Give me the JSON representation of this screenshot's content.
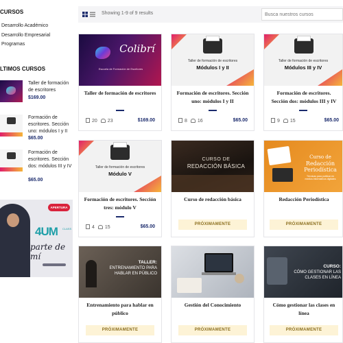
{
  "sidebar": {
    "categories_heading": "CURSOS",
    "categories": [
      "Desarrollo Académico",
      "Desarrollo Empresarial",
      "Programas"
    ],
    "recent_heading": "LTIMOS CURSOS",
    "recent": [
      {
        "title": "Taller de formación de escritores",
        "price": "$169.00"
      },
      {
        "title": "Formación de escritores. Sección uno: módulos I y II",
        "price": "$65.00"
      },
      {
        "title": "Formación de escritores. Sección dos: módulos III y IV",
        "price": "$65.00"
      }
    ],
    "promo": {
      "badge": "APERTURA",
      "logo": "4UM",
      "logo_small": "CLASS",
      "tagline": "parte de mí"
    }
  },
  "toolbar": {
    "results": "Showing 1-9 of 9 results",
    "search_placeholder": "Busca nuestros cursos"
  },
  "cards": [
    {
      "title": "Taller de formación de escritores",
      "lessons": "20",
      "students": "23",
      "price": "$169.00",
      "img": {
        "line1": "Colibrí",
        "line2": "Escuela de Formación de Escritores"
      }
    },
    {
      "title": "Formación de escritores. Sección uno: módulos I y II",
      "lessons": "8",
      "students": "16",
      "price": "$65.00",
      "img": {
        "line1": "Taller de formación de escritores",
        "line2": "Módulos I y II"
      }
    },
    {
      "title": "Formación de escritores. Sección dos: módulos III y IV",
      "lessons": "9",
      "students": "15",
      "price": "$65.00",
      "img": {
        "line1": "Taller de formación de escritores",
        "line2": "Módulos III y IV"
      }
    },
    {
      "title": "Formación de escritores. Sección tres: módulo V",
      "lessons": "4",
      "students": "15",
      "price": "$65.00",
      "img": {
        "line1": "Taller de formación de escritores",
        "line2": "Módulo V"
      }
    },
    {
      "title": "Curso de redacción básica",
      "soon": "PRÓXIMAMENTE",
      "img": {
        "line1": "CURSO DE",
        "line2": "REDACCIÓN BÁSICA"
      }
    },
    {
      "title": "Redacción Periodística",
      "soon": "PRÓXIMAMENTE",
      "img": {
        "line1": "Curso de",
        "line2": "Redacción Periodística",
        "line3": "Técnicas para publicar en medios informativos digitales"
      }
    },
    {
      "title": "Entrenamiento para hablar en público",
      "soon": "PRÓXIMAMENTE",
      "img": {
        "line1": "TALLER:",
        "line2": "ENTRENAMIENTO PARA HABLAR EN PÚBLICO"
      }
    },
    {
      "title": "Gestión del Conocimiento",
      "soon": "PRÓXIMAMENTE",
      "img": {}
    },
    {
      "title": "Cómo gestionar las clases en línea",
      "soon": "PRÓXIMAMENTE",
      "img": {
        "line1": "CURSO:",
        "line2": "CÓMO GESTIONAR LAS CLASES EN LÍNEA"
      }
    }
  ],
  "colors": {
    "accent": "#1a2a6c",
    "soon_bg": "#fdf3d6",
    "topbar_bg": "#f4f4f6"
  }
}
